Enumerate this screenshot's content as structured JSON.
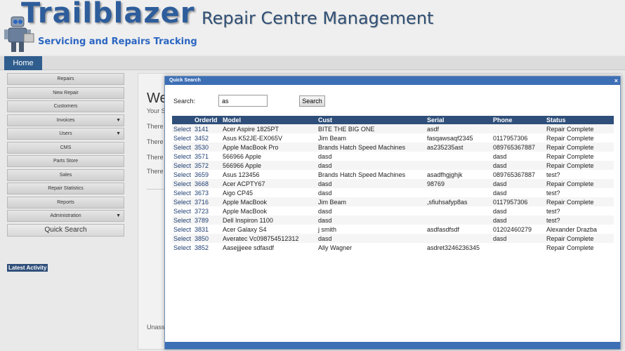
{
  "header": {
    "brand": "Trailblazer",
    "tagline": "Servicing and Repairs Tracking",
    "app_title": "Repair Centre Management"
  },
  "nav": {
    "home": "Home"
  },
  "sidebar": {
    "items": [
      {
        "label": "Repairs",
        "has_arrow": false
      },
      {
        "label": "New Repair",
        "has_arrow": false
      },
      {
        "label": "Customers",
        "has_arrow": false
      },
      {
        "label": "Invoices",
        "has_arrow": true
      },
      {
        "label": "Users",
        "has_arrow": true
      },
      {
        "label": "CMS",
        "has_arrow": false
      },
      {
        "label": "Parts Store",
        "has_arrow": false
      },
      {
        "label": "Sales",
        "has_arrow": false
      },
      {
        "label": "Repair Statistics",
        "has_arrow": false
      },
      {
        "label": "Reports",
        "has_arrow": false
      },
      {
        "label": "Administration",
        "has_arrow": true
      }
    ],
    "quick_search": "Quick Search",
    "latest_activity": "Latest Activity"
  },
  "main": {
    "welcome": "We",
    "sub": "Your S",
    "there_lines": [
      "There",
      "There",
      "There",
      "There"
    ],
    "unassigned": "Unass"
  },
  "modal": {
    "title": "Quick Search",
    "close": "×",
    "search_label": "Search:",
    "search_value": "as",
    "search_button": "Search",
    "columns": [
      "",
      "OrderId",
      "Model",
      "Cust",
      "Serial",
      "Phone",
      "Status"
    ],
    "rows": [
      {
        "select": "Select",
        "order": "3141",
        "model": "Acer Aspire 1825PT",
        "cust": "BITE THE BIG ONE",
        "serial": "asdf",
        "phone": "",
        "status": "Repair Complete"
      },
      {
        "select": "Select",
        "order": "3452",
        "model": "Asus K52JE-EX065V",
        "cust": "Jim Beam",
        "serial": "fasqawsaqf2345",
        "phone": "0117957306",
        "status": "Repair Complete"
      },
      {
        "select": "Select",
        "order": "3530",
        "model": "Apple MacBook Pro",
        "cust": "Brands Hatch Speed Machines",
        "serial": "as235235ast",
        "phone": "089765367887",
        "status": "Repair Complete"
      },
      {
        "select": "Select",
        "order": "3571",
        "model": "566966 Apple",
        "cust": "dasd",
        "serial": "",
        "phone": "dasd",
        "status": "Repair Complete"
      },
      {
        "select": "Select",
        "order": "3572",
        "model": "566966 Apple",
        "cust": "dasd",
        "serial": "",
        "phone": "dasd",
        "status": "Repair Complete"
      },
      {
        "select": "Select",
        "order": "3659",
        "model": "Asus 123456",
        "cust": "Brands Hatch Speed Machines",
        "serial": "asadfhgjghjk",
        "phone": "089765367887",
        "status": "test?"
      },
      {
        "select": "Select",
        "order": "3668",
        "model": "Acer ACPTY67",
        "cust": "dasd",
        "serial": "98769",
        "phone": "dasd",
        "status": "Repair Complete"
      },
      {
        "select": "Select",
        "order": "3673",
        "model": "Aigo CP45",
        "cust": "dasd",
        "serial": "",
        "phone": "dasd",
        "status": "test?"
      },
      {
        "select": "Select",
        "order": "3716",
        "model": "Apple MacBook",
        "cust": "Jim Beam",
        "serial": ",sfiuhsafyp8as",
        "phone": "0117957306",
        "status": "Repair Complete"
      },
      {
        "select": "Select",
        "order": "3723",
        "model": "Apple MacBook",
        "cust": "dasd",
        "serial": "",
        "phone": "dasd",
        "status": "test?"
      },
      {
        "select": "Select",
        "order": "3789",
        "model": "Dell Inspiron 1100",
        "cust": "dasd",
        "serial": "",
        "phone": "dasd",
        "status": "test?"
      },
      {
        "select": "Select",
        "order": "3831",
        "model": "Acer Galaxy S4",
        "cust": "j smith",
        "serial": "asdfasdfsdf",
        "phone": "01202460279",
        "status": "Alexander Drazba"
      },
      {
        "select": "Select",
        "order": "3850",
        "model": "Averatec Vc098754512312",
        "cust": "dasd",
        "serial": "",
        "phone": "dasd",
        "status": "Repair Complete"
      },
      {
        "select": "Select",
        "order": "3852",
        "model": "Aasejjjeee sdfasdf",
        "cust": "Ally Wagner",
        "serial": "asdret3246236345",
        "phone": "",
        "status": "Repair Complete"
      }
    ]
  }
}
